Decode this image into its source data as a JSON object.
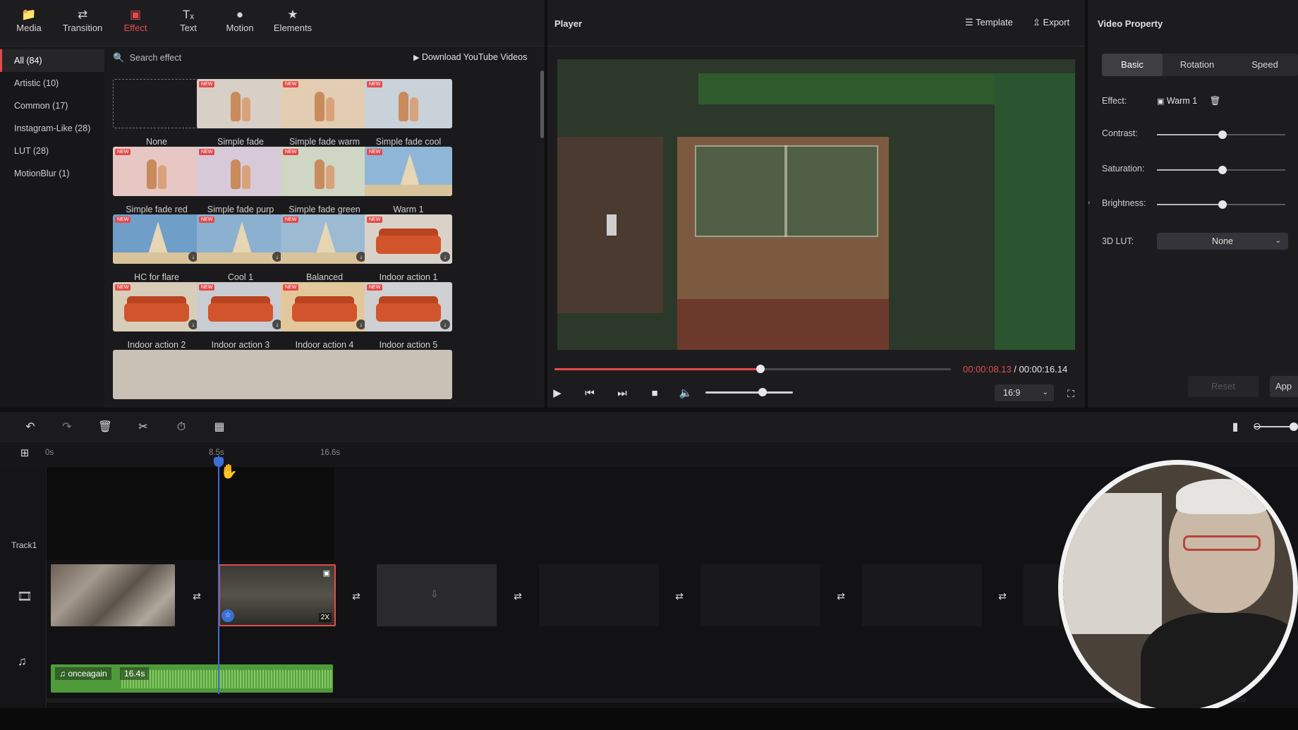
{
  "toolbar": {
    "items": [
      {
        "label": "Media",
        "icon": "folder-icon"
      },
      {
        "label": "Transition",
        "icon": "swap-icon"
      },
      {
        "label": "Effect",
        "icon": "effect-icon",
        "active": true
      },
      {
        "label": "Text",
        "icon": "text-icon"
      },
      {
        "label": "Motion",
        "icon": "motion-icon"
      },
      {
        "label": "Elements",
        "icon": "elements-icon"
      }
    ]
  },
  "categories": [
    {
      "label": "All (84)",
      "selected": true
    },
    {
      "label": "Artistic (10)"
    },
    {
      "label": "Common (17)"
    },
    {
      "label": "Instagram-Like (28)"
    },
    {
      "label": "LUT (28)"
    },
    {
      "label": "MotionBlur (1)"
    }
  ],
  "search": {
    "placeholder": "Search effect"
  },
  "download": {
    "label": "Download YouTube Videos"
  },
  "badges": {
    "new": "NEW"
  },
  "effects": [
    {
      "label": "None",
      "kind": "none"
    },
    {
      "label": "Simple fade",
      "kind": "vase",
      "tint": "#d8cfc6"
    },
    {
      "label": "Simple fade warm",
      "kind": "vase",
      "tint": "#e2cdb3"
    },
    {
      "label": "Simple fade cool",
      "kind": "vase",
      "tint": "#c9d2d8"
    },
    {
      "label": "Simple fade red",
      "kind": "vase",
      "tint": "#e6c7c4"
    },
    {
      "label": "Simple fade purp",
      "kind": "vase",
      "tint": "#d8c9d8"
    },
    {
      "label": "Simple fade green",
      "kind": "vase",
      "tint": "#cfd6c4"
    },
    {
      "label": "Warm 1",
      "kind": "sail",
      "tint": "#8fb6d6"
    },
    {
      "label": "HC for flare",
      "kind": "sail",
      "tint": "#6f9ec9"
    },
    {
      "label": "Cool 1",
      "kind": "sail",
      "tint": "#8cb0d0"
    },
    {
      "label": "Balanced",
      "kind": "sail",
      "tint": "#9cbad2"
    },
    {
      "label": "Indoor action 1",
      "kind": "sofa",
      "tint": "#d9d2c9"
    },
    {
      "label": "Indoor action 2",
      "kind": "sofa",
      "tint": "#d8cdb8"
    },
    {
      "label": "Indoor action 3",
      "kind": "sofa",
      "tint": "#c9ccd2"
    },
    {
      "label": "Indoor action 4",
      "kind": "sofa",
      "tint": "#e2c79a"
    },
    {
      "label": "Indoor action 5",
      "kind": "sofa",
      "tint": "#cfd0d3"
    }
  ],
  "player": {
    "title": "Player",
    "template_label": "Template",
    "export_label": "Export",
    "time_current": "00:00:08.13",
    "time_separator": " / ",
    "time_total": "00:00:16.14",
    "progress": 0.52,
    "volume": 0.65,
    "aspect": "16:9"
  },
  "property": {
    "title": "Video Property",
    "tabs": [
      "Basic",
      "Rotation",
      "Speed"
    ],
    "active_tab": 0,
    "effect_label": "Effect:",
    "effect_value": "Warm 1",
    "contrast_label": "Contrast:",
    "contrast": 0.51,
    "saturation_label": "Saturation:",
    "saturation": 0.51,
    "brightness_label": "Brightness:",
    "brightness": 0.51,
    "lut_label": "3D LUT:",
    "lut_value": "None",
    "reset_label": "Reset",
    "apply_label": "App"
  },
  "timeline": {
    "ruler": [
      "0s",
      "8.5s",
      "16.6s"
    ],
    "track_label": "Track1",
    "clip_speed": "2X",
    "audio_name": "onceagain",
    "audio_duration": "16.4s"
  },
  "colors": {
    "accent": "#e34b4b",
    "playhead": "#3b6fd4",
    "audio": "#4f9a3a"
  }
}
